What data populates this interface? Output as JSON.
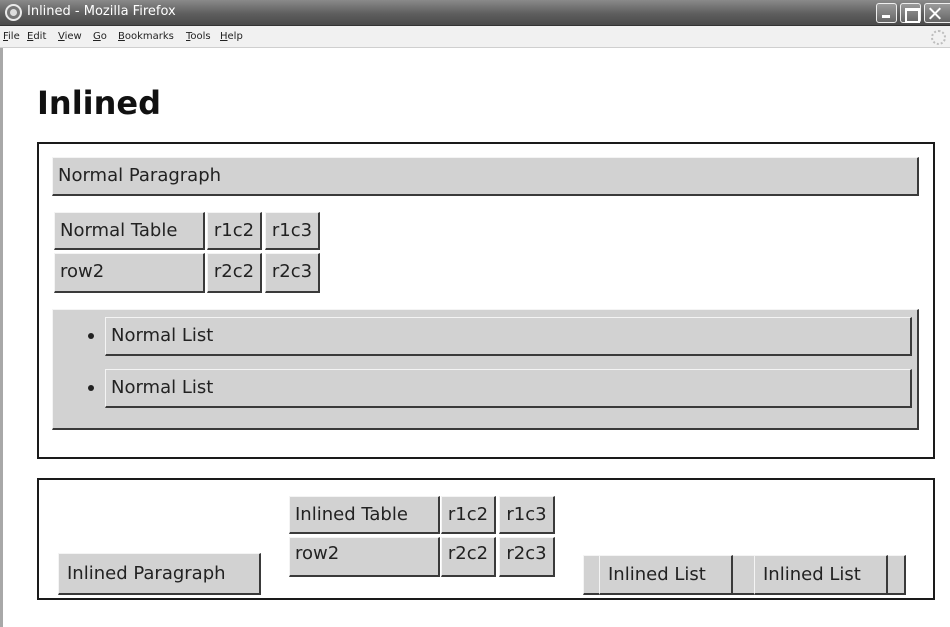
{
  "window": {
    "title": "Inlined - Mozilla Firefox",
    "menu": [
      "File",
      "Edit",
      "View",
      "Go",
      "Bookmarks",
      "Tools",
      "Help"
    ]
  },
  "page": {
    "heading": "Inlined",
    "normal": {
      "paragraph": "Normal Paragraph",
      "table": [
        [
          "Normal Table",
          "r1c2",
          "r1c3"
        ],
        [
          "row2",
          "r2c2",
          "r2c3"
        ]
      ],
      "list": [
        "Normal List",
        "Normal List"
      ]
    },
    "inlined": {
      "paragraph": "Inlined Paragraph",
      "table": [
        [
          "Inlined Table",
          "r1c2",
          "r1c3"
        ],
        [
          "row2",
          "r2c2",
          "r2c3"
        ]
      ],
      "list": [
        "Inlined List",
        "Inlined List"
      ]
    }
  }
}
